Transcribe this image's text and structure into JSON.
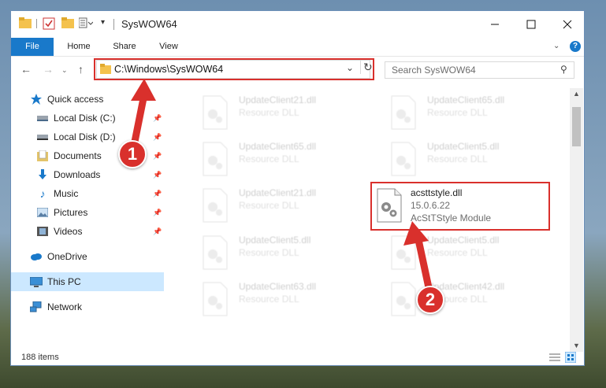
{
  "window": {
    "title": "SysWOW64"
  },
  "ribbon": {
    "tabs": [
      "File",
      "Home",
      "Share",
      "View"
    ]
  },
  "address": {
    "path": "C:\\Windows\\SysWOW64"
  },
  "search": {
    "placeholder": "Search SysWOW64"
  },
  "sidebar": {
    "items": [
      {
        "label": "Quick access",
        "icon": "star-icon"
      },
      {
        "label": "Local Disk (C:)",
        "icon": "drive-icon",
        "pinned": true
      },
      {
        "label": "Local Disk (D:)",
        "icon": "drive-icon",
        "pinned": true
      },
      {
        "label": "Documents",
        "icon": "documents-icon",
        "pinned": true
      },
      {
        "label": "Downloads",
        "icon": "download-icon",
        "pinned": true
      },
      {
        "label": "Music",
        "icon": "music-icon",
        "pinned": true
      },
      {
        "label": "Pictures",
        "icon": "pictures-icon",
        "pinned": true
      },
      {
        "label": "Videos",
        "icon": "videos-icon",
        "pinned": true
      },
      {
        "label": "OneDrive",
        "icon": "cloud-icon"
      },
      {
        "label": "This PC",
        "icon": "computer-icon",
        "selected": true
      },
      {
        "label": "Network",
        "icon": "network-icon"
      }
    ]
  },
  "files": [
    {
      "name": "UpdateClient21.dll",
      "type": "Resource DLL"
    },
    {
      "name": "UpdateClient65.dll",
      "type": "Resource DLL"
    },
    {
      "name": "UpdateClient65.dll",
      "type": "Resource DLL"
    },
    {
      "name": "UpdateClient5.dll",
      "type": "Resource DLL"
    },
    {
      "name": "UpdateClient21.dll",
      "type": "Resource DLL"
    },
    {
      "name": "acsttstyle.dll",
      "version": "15.0.6.22",
      "type": "AcStTStyle Module",
      "highlighted": true
    },
    {
      "name": "UpdateClient5.dll",
      "type": "Resource DLL"
    },
    {
      "name": "UpdateClient5.dll",
      "type": "Resource DLL"
    },
    {
      "name": "UpdateClient63.dll",
      "type": "Resource DLL"
    },
    {
      "name": "UpdateClient42.dll",
      "type": "Resource DLL"
    }
  ],
  "status": {
    "items_count": "188 items"
  },
  "annotations": {
    "step1": "1",
    "step2": "2"
  },
  "colors": {
    "accent": "#1979ca",
    "highlight": "#d9302c",
    "selected": "#cce8ff"
  }
}
